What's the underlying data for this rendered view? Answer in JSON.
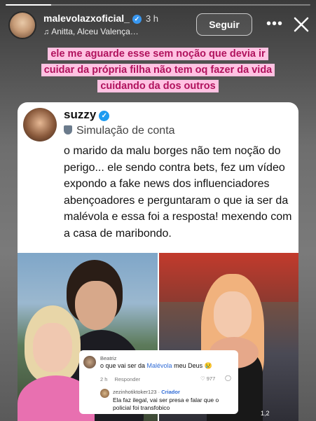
{
  "story": {
    "progress": 0.15
  },
  "header": {
    "username": "malevolazxoficial_",
    "time": "3 h",
    "music": "Anitta, Alceu Valença…",
    "follow_label": "Seguir",
    "more_label": "•••"
  },
  "caption": {
    "line1": "ele me aguarde esse sem noção que devia ir",
    "line2": "cuidar da própria filha não tem oq fazer da vida",
    "line3": "cuidando da dos outros"
  },
  "tweet": {
    "name": "suzzy",
    "simulation": "Simulação de conta",
    "text": "o marido da malu borges não tem noção do perigo... ele sendo contra bets, fez um vídeo expondo a fake news dos influenciadores abençoadores e perguntaram o que ia ser da malévola e essa foi a resposta! mexendo com a casa de maribondo."
  },
  "comment": {
    "user1": "Beatriz",
    "text1_before": "o que vai ser da ",
    "text1_accent": "Malévola",
    "text1_after": " meu Deus 😢",
    "time1": "2 h",
    "reply_label": "Responder",
    "likes": "977",
    "user2": "zezinhotiktoker123",
    "creator_label": "Criador",
    "text2": "Ela faz ilegal, vai ser presa e falar que o policial foi transfobico"
  },
  "corner_text": "1,2"
}
